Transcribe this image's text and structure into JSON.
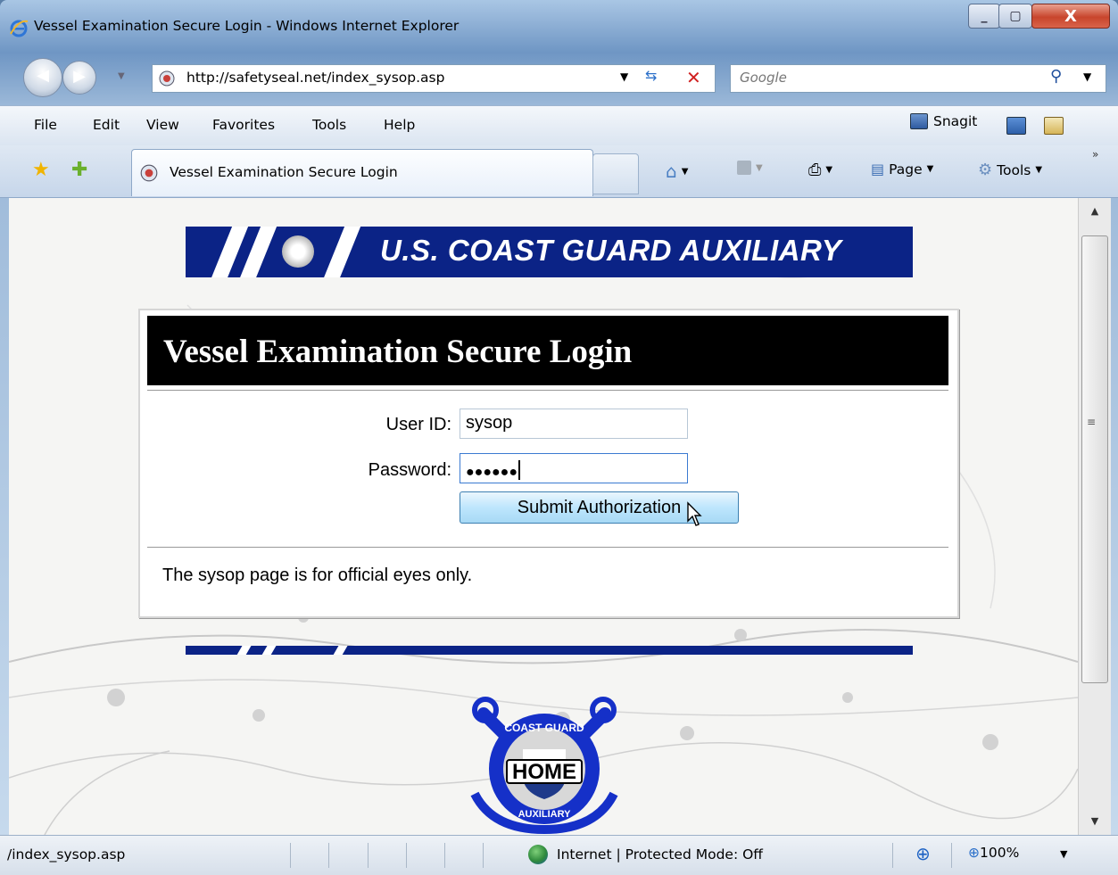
{
  "window": {
    "title": "Vessel Examination Secure Login - Windows Internet Explorer",
    "minimize": "_",
    "maximize": "▢",
    "close": "X"
  },
  "addressbar": {
    "url": "http://safetyseal.net/index_sysop.asp",
    "search_placeholder": "Google"
  },
  "menu": {
    "items": [
      "File",
      "Edit",
      "View",
      "Favorites",
      "Tools",
      "Help"
    ],
    "snagit": "Snagit"
  },
  "tabs": {
    "active_label": "Vessel Examination Secure Login"
  },
  "commandbar": {
    "page": "Page",
    "tools": "Tools"
  },
  "page": {
    "banner_title": "U.S. COAST GUARD AUXILIARY",
    "login_title": "Vessel Examination Secure Login",
    "userid_label": "User ID:",
    "userid_value": "sysop",
    "password_label": "Password:",
    "password_mask": "●●●●●●",
    "submit_label": "Submit Authorization",
    "note": "The sysop page is for official eyes only.",
    "home_logo_text": "HOME",
    "home_logo_ring_top": "COAST GUARD",
    "home_logo_ring_bottom": "AUXILIARY"
  },
  "statusbar": {
    "path": "/index_sysop.asp",
    "zone": "Internet | Protected Mode: Off",
    "zoom": "100%"
  },
  "colors": {
    "banner_navy": "#0b2386",
    "login_header_bg": "#000000",
    "button_blue": "#bee6fd"
  }
}
